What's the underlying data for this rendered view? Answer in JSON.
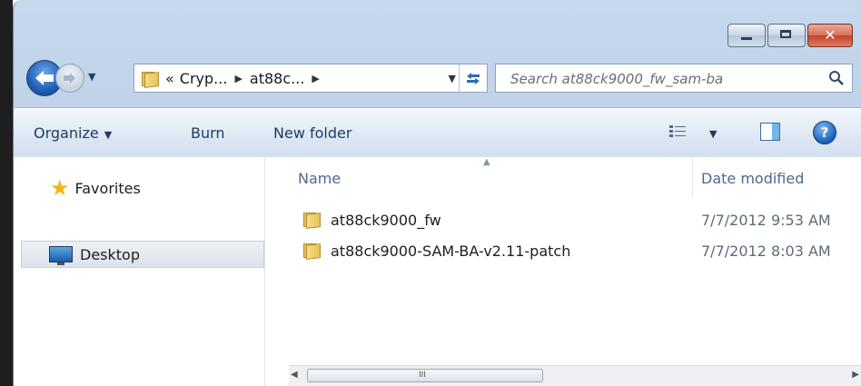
{
  "nav": {
    "breadcrumb": [
      {
        "label": "Cryp..."
      },
      {
        "label": "at88c..."
      }
    ],
    "breadcrumb_prefix": "«",
    "search_placeholder": "Search at88ck9000_fw_sam-ba"
  },
  "window_buttons": {
    "close_glyph": "✕"
  },
  "toolbar": {
    "organize": "Organize",
    "burn": "Burn",
    "new_folder": "New folder"
  },
  "sidebar": {
    "favorites": "Favorites",
    "desktop": "Desktop"
  },
  "columns": {
    "name": "Name",
    "date_modified": "Date modified"
  },
  "files": [
    {
      "name": "at88ck9000_fw",
      "date": "7/7/2012 9:53 AM"
    },
    {
      "name": "at88ck9000-SAM-BA-v2.11-patch",
      "date": "7/7/2012 8:03 AM"
    }
  ],
  "scrollbar": {
    "grip": "III"
  },
  "icons": {
    "back": "back-arrow-icon",
    "forward": "forward-arrow-icon",
    "search": "search-icon",
    "help": "help-icon",
    "favorites": "star-icon",
    "desktop": "desktop-icon",
    "folder": "folder-icon"
  },
  "colors": {
    "chrome": "#b9cde5",
    "close_button": "#c5432c",
    "header_text": "#4d6a8c"
  }
}
